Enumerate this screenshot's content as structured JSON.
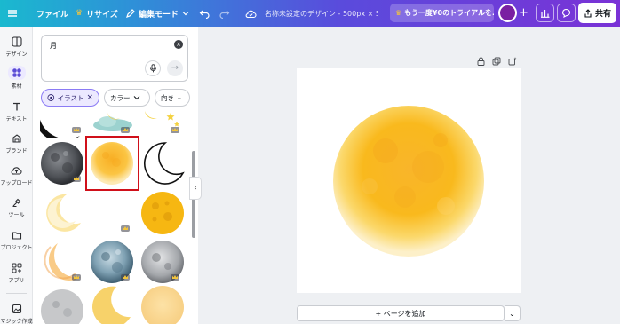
{
  "topbar": {
    "file_label": "ファイル",
    "resize_label": "リサイズ",
    "edit_mode_label": "編集モード",
    "doc_title": "名称未設定のデザイン - 500px × 5...",
    "trial_label": "もう一度¥0のトライアルを...",
    "share_label": "共有"
  },
  "rail": {
    "items": [
      {
        "label": "デザイン"
      },
      {
        "label": "素材"
      },
      {
        "label": "テキスト"
      },
      {
        "label": "ブランド"
      },
      {
        "label": "アップロード"
      },
      {
        "label": "ツール"
      },
      {
        "label": "プロジェクト"
      },
      {
        "label": "アプリ"
      },
      {
        "label": "マジック作成"
      }
    ]
  },
  "search": {
    "value": "月"
  },
  "filters": {
    "chips": [
      {
        "label": "イラスト"
      },
      {
        "label": "カラー"
      },
      {
        "label": "向き"
      }
    ]
  },
  "canvas": {
    "add_page_label": "+ ページを追加"
  },
  "colors": {
    "brand_gradient_start": "#1ab9cf",
    "brand_gradient_end": "#7a32d6",
    "selection_outline": "#d0101a",
    "moon_yellow": "#f9b91d",
    "active_chip": "#8b7bf5"
  }
}
